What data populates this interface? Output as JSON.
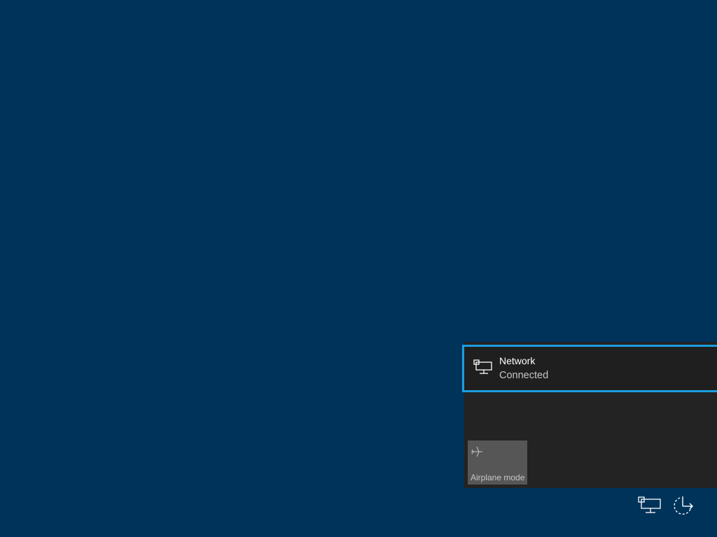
{
  "network_flyout": {
    "network": {
      "name": "Network",
      "status": "Connected",
      "icon": "wired-network-icon"
    },
    "quick_actions": [
      {
        "label": "Airplane mode",
        "icon": "airplane-icon",
        "state": "off"
      }
    ]
  },
  "taskbar_tray": {
    "icons": [
      "network-tray-icon",
      "power-options-icon"
    ]
  },
  "colors": {
    "desktop_background": "#00335a",
    "flyout_background": "#232323",
    "accent": "#1a9ee0",
    "tile_background": "#565656"
  }
}
